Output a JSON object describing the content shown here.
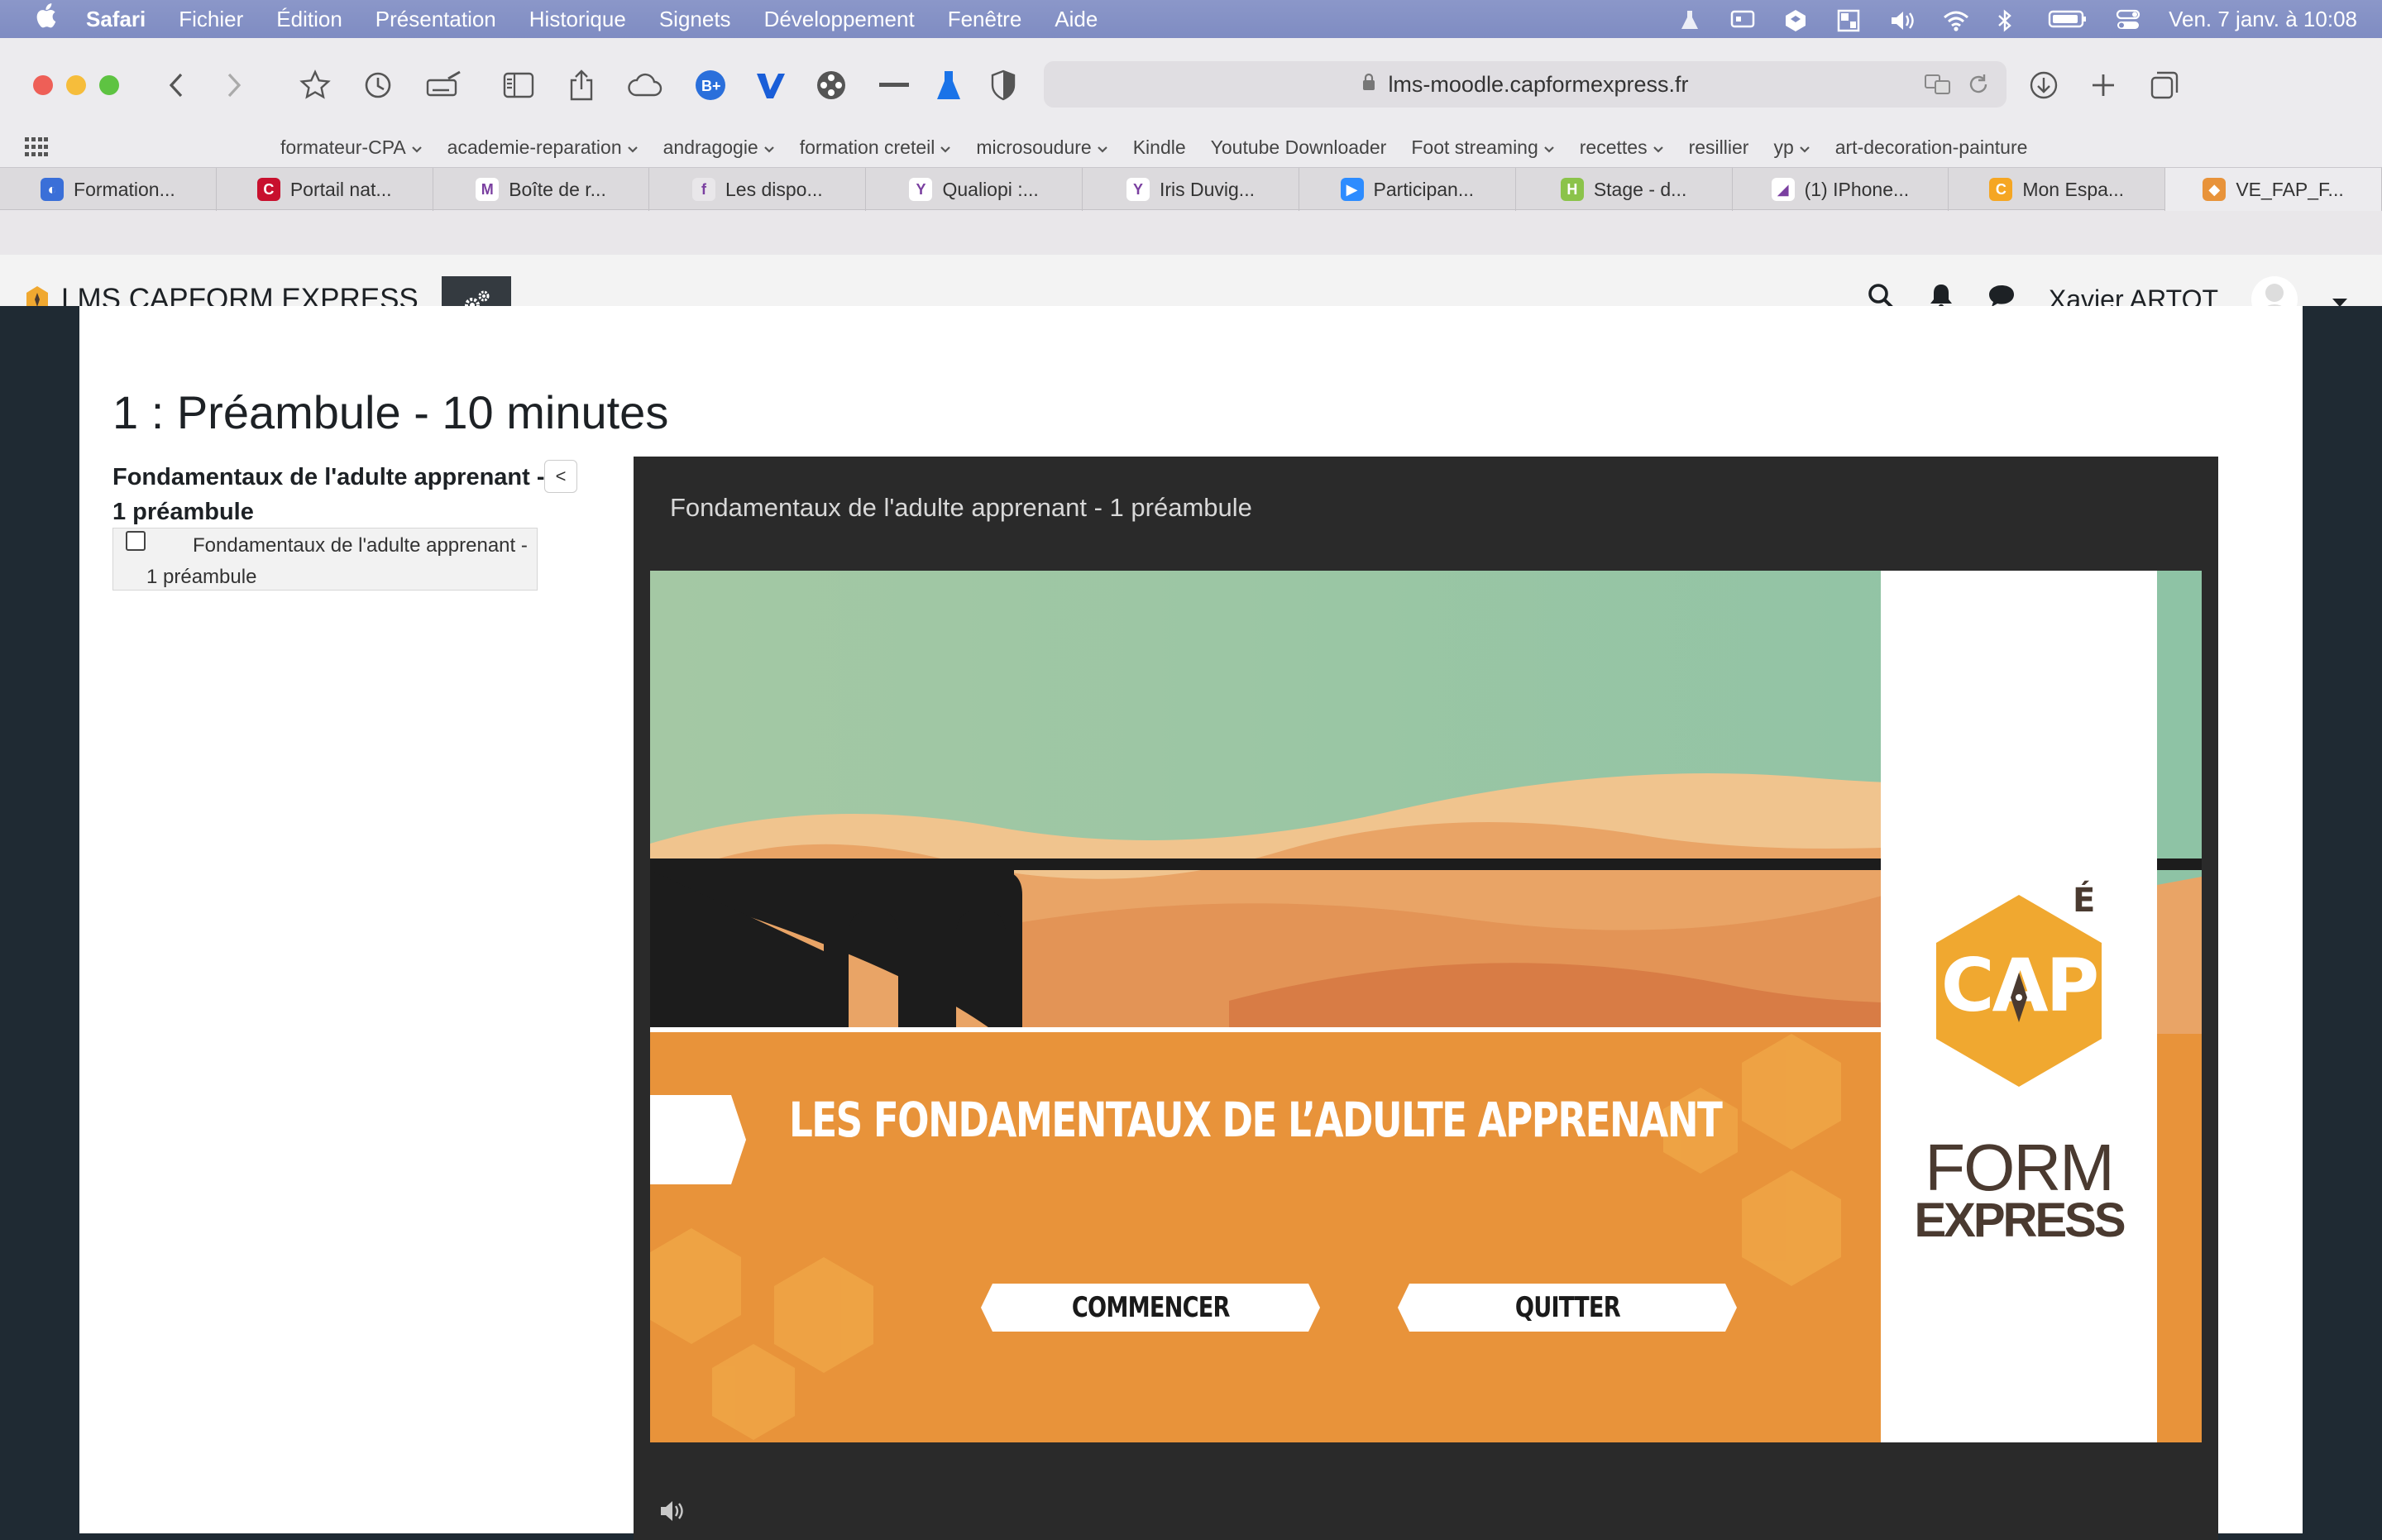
{
  "menubar": {
    "apple": "",
    "items": [
      "Safari",
      "Fichier",
      "Édition",
      "Présentation",
      "Historique",
      "Signets",
      "Développement",
      "Fenêtre",
      "Aide"
    ],
    "clock": "Ven. 7 janv. à  10:08"
  },
  "browser": {
    "url": "lms-moodle.capformexpress.fr",
    "favorites": [
      {
        "label": "formateur-CPA",
        "menu": true
      },
      {
        "label": "academie-reparation",
        "menu": true
      },
      {
        "label": "andragogie",
        "menu": true
      },
      {
        "label": "formation creteil",
        "menu": true
      },
      {
        "label": "microsoudure",
        "menu": true
      },
      {
        "label": "Kindle",
        "menu": false
      },
      {
        "label": "Youtube Downloader",
        "menu": false
      },
      {
        "label": "Foot streaming",
        "menu": true
      },
      {
        "label": "recettes",
        "menu": true
      },
      {
        "label": "resillier",
        "menu": false
      },
      {
        "label": "yp",
        "menu": true
      },
      {
        "label": "art-decoration-painture",
        "menu": false
      }
    ],
    "tabs": [
      {
        "label": "Formation...",
        "color": "#3a6fd8",
        "glyph": "◐"
      },
      {
        "label": "Portail nat...",
        "color": "#c8102e",
        "glyph": "C"
      },
      {
        "label": "Boîte de r...",
        "color": "#ffffff",
        "glyph": "M"
      },
      {
        "label": "Les dispo...",
        "color": "#e9e7ea",
        "glyph": "f"
      },
      {
        "label": "Qualiopi :...",
        "color": "#ffffff",
        "glyph": "Y"
      },
      {
        "label": "Iris Duvig...",
        "color": "#ffffff",
        "glyph": "Y"
      },
      {
        "label": "Participan...",
        "color": "#2d8cff",
        "glyph": "▶"
      },
      {
        "label": "Stage - d...",
        "color": "#8bc34a",
        "glyph": "H"
      },
      {
        "label": "(1) IPhone...",
        "color": "#ffffff",
        "glyph": "◢"
      },
      {
        "label": "Mon Espa...",
        "color": "#f5a623",
        "glyph": "C"
      },
      {
        "label": "VE_FAP_F...",
        "color": "#e8933a",
        "glyph": "◆"
      }
    ]
  },
  "moodle": {
    "site_name": "LMS CAPFORM EXPRESS",
    "user_name": "Xavier ARTOT"
  },
  "page": {
    "title": "1 : Préambule - 10 minutes",
    "toc_title": "Fondamentaux de l'adulte apprenant - 1 préambule",
    "toc_collapse": "<",
    "toc_item": "Fondamentaux de l'adulte apprenant - 1 préambule",
    "player_title": "Fondamentaux de l'adulte apprenant - 1 préambule"
  },
  "slide": {
    "banner": "LES FONDAMENTAUX DE L’ADULTE APPRENANT",
    "start_button": "COMMENCER",
    "quit_button": "QUITTER",
    "logo_cap": "CAP",
    "logo_accent": "É",
    "logo_form": "FORM",
    "logo_express": "EXPRESS"
  },
  "colors": {
    "accent_orange": "#e8933a",
    "sky_green": "#9cc4a3",
    "dark_header": "#343a40",
    "player_bg": "#2a2a2a",
    "logo_brown": "#4a3a30"
  }
}
